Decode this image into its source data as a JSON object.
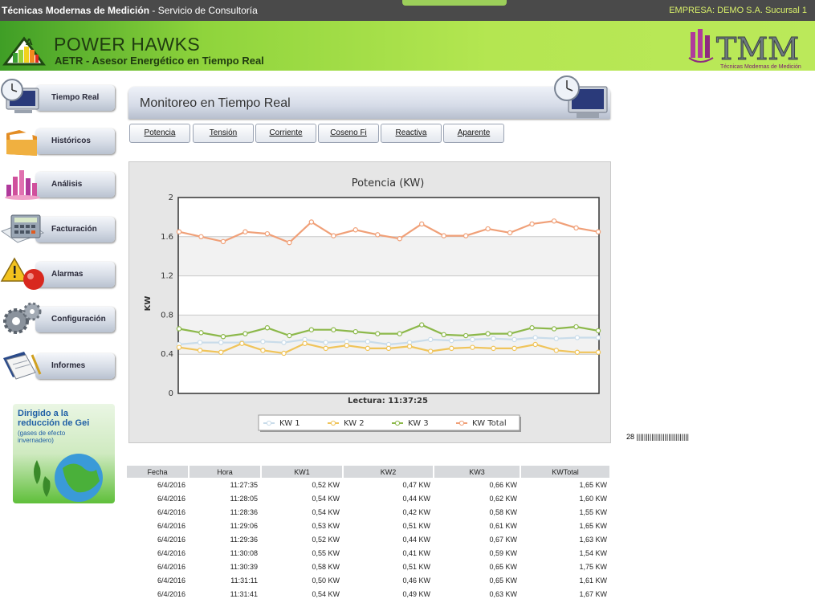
{
  "topbar": {
    "company": "Técnicas Modernas de Medición",
    "service": " - Servicio de Consultoría",
    "empresa": "EMPRESA: DEMO S.A. Sucursal 1"
  },
  "banner": {
    "title": "POWER HAWKS",
    "subtitle": "AETR - Asesor Energético en Tiempo Real",
    "brand_logo_text": "TMM",
    "brand_tagline": "Técnicas Modernas de Medición"
  },
  "sidebar": {
    "items": [
      {
        "label": "Tiempo Real",
        "icon": "clock-monitor-icon"
      },
      {
        "label": "Históricos",
        "icon": "folder-icon"
      },
      {
        "label": "Análisis",
        "icon": "bar-chart-icon"
      },
      {
        "label": "Facturación",
        "icon": "calculator-icon"
      },
      {
        "label": "Alarmas",
        "icon": "warning-alarm-icon"
      },
      {
        "label": "Configuración",
        "icon": "gears-icon"
      },
      {
        "label": "Informes",
        "icon": "documents-icon"
      }
    ],
    "promo": {
      "line1": "Dirigido a la reducción de Gei",
      "line2": "(gases de efecto invernadero)"
    }
  },
  "panel": {
    "title": "Monitoreo en Tiempo Real"
  },
  "tabs": [
    "Potencia",
    "Tensión",
    "Corriente",
    "Coseno Fi",
    "Reactiva",
    "Aparente"
  ],
  "chart_data": {
    "type": "line",
    "title": "Potencia (KW)",
    "ylabel": "KW",
    "xlabel": "Lectura: 11:37:25",
    "ylim": [
      0,
      2
    ],
    "yticks": [
      "0",
      "0.4",
      "0.8",
      "1.2",
      "1.6",
      "2"
    ],
    "grid": true,
    "legend": "bottom",
    "series": [
      {
        "name": "KW 1",
        "color": "#c9dcea",
        "values": [
          0.5,
          0.52,
          0.52,
          0.52,
          0.53,
          0.52,
          0.55,
          0.52,
          0.53,
          0.53,
          0.5,
          0.52,
          0.55,
          0.54,
          0.55,
          0.56,
          0.55,
          0.57,
          0.56,
          0.57,
          0.57
        ]
      },
      {
        "name": "KW 2",
        "color": "#f0c45a",
        "values": [
          0.47,
          0.44,
          0.42,
          0.51,
          0.44,
          0.41,
          0.51,
          0.46,
          0.49,
          0.46,
          0.46,
          0.48,
          0.43,
          0.46,
          0.47,
          0.46,
          0.46,
          0.5,
          0.44,
          0.42,
          0.42
        ]
      },
      {
        "name": "KW 3",
        "color": "#8cb84a",
        "values": [
          0.66,
          0.62,
          0.58,
          0.61,
          0.67,
          0.59,
          0.65,
          0.65,
          0.63,
          0.61,
          0.61,
          0.7,
          0.6,
          0.59,
          0.61,
          0.61,
          0.67,
          0.66,
          0.68,
          0.64
        ]
      },
      {
        "name": "KW Total",
        "color": "#f0a078",
        "values": [
          1.65,
          1.6,
          1.55,
          1.65,
          1.63,
          1.54,
          1.75,
          1.61,
          1.67,
          1.62,
          1.58,
          1.73,
          1.61,
          1.61,
          1.68,
          1.64,
          1.73,
          1.76,
          1.69,
          1.65
        ]
      }
    ]
  },
  "counter": "28 ||||||||||||||||||||||||||||",
  "table": {
    "headers": [
      "Fecha",
      "Hora",
      "KW1",
      "KW2",
      "KW3",
      "KWTotal"
    ],
    "rows": [
      [
        "6/4/2016",
        "11:27:35",
        "0,52 KW",
        "0,47 KW",
        "0,66 KW",
        "1,65 KW"
      ],
      [
        "6/4/2016",
        "11:28:05",
        "0,54 KW",
        "0,44 KW",
        "0,62 KW",
        "1,60 KW"
      ],
      [
        "6/4/2016",
        "11:28:36",
        "0,54 KW",
        "0,42 KW",
        "0,58 KW",
        "1,55 KW"
      ],
      [
        "6/4/2016",
        "11:29:06",
        "0,53 KW",
        "0,51 KW",
        "0,61 KW",
        "1,65 KW"
      ],
      [
        "6/4/2016",
        "11:29:36",
        "0,52 KW",
        "0,44 KW",
        "0,67 KW",
        "1,63 KW"
      ],
      [
        "6/4/2016",
        "11:30:08",
        "0,55 KW",
        "0,41 KW",
        "0,59 KW",
        "1,54 KW"
      ],
      [
        "6/4/2016",
        "11:30:39",
        "0,58 KW",
        "0,51 KW",
        "0,65 KW",
        "1,75 KW"
      ],
      [
        "6/4/2016",
        "11:31:11",
        "0,50 KW",
        "0,46 KW",
        "0,65 KW",
        "1,61 KW"
      ],
      [
        "6/4/2016",
        "11:31:41",
        "0,54 KW",
        "0,49 KW",
        "0,63 KW",
        "1,67 KW"
      ]
    ]
  }
}
